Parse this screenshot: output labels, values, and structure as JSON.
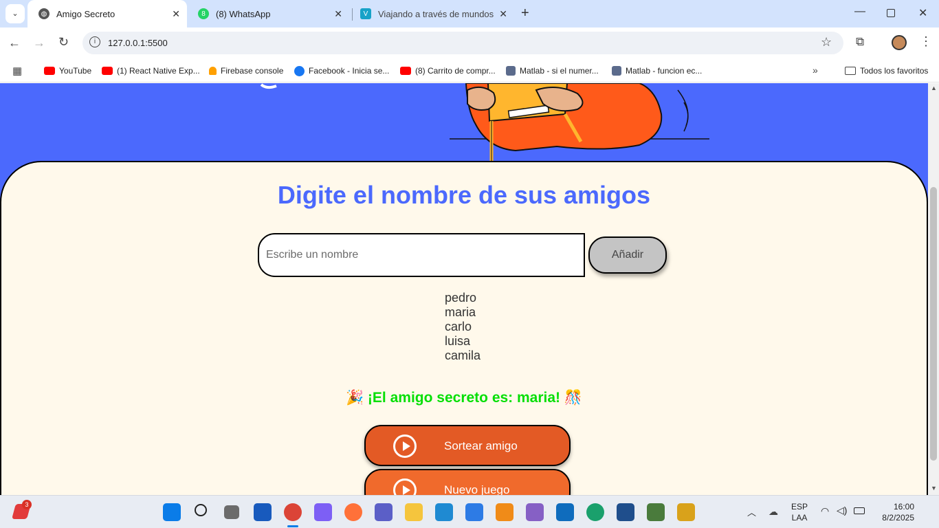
{
  "browser": {
    "tabs": [
      {
        "title": "Amigo Secreto",
        "active": true
      },
      {
        "title": "(8) WhatsApp",
        "active": false
      },
      {
        "title": "Viajando a través de mundos ci",
        "active": false
      }
    ],
    "address": "127.0.0.1:5500",
    "bookmarks": [
      {
        "label": "YouTube",
        "icon": "youtube-icon"
      },
      {
        "label": "(1) React Native Exp...",
        "icon": "youtube-icon"
      },
      {
        "label": "Firebase console",
        "icon": "firebase-icon"
      },
      {
        "label": "Facebook - Inicia se...",
        "icon": "facebook-icon"
      },
      {
        "label": "(8) Carrito de compr...",
        "icon": "youtube-icon"
      },
      {
        "label": "Matlab - si el numer...",
        "icon": "page-icon"
      },
      {
        "label": "Matlab - funcion ec...",
        "icon": "page-icon"
      }
    ],
    "all_bookmarks_label": "Todos los favoritos"
  },
  "page": {
    "heading": "Digite el nombre de sus amigos",
    "input_placeholder": "Escribe un nombre",
    "add_button": "Añadir",
    "friends": [
      "pedro",
      "maria",
      "carlo",
      "luisa",
      "camila"
    ],
    "result": "🎉 ¡El amigo secreto es: maria! 🎊",
    "draw_button": "Sortear amigo",
    "new_game_button": "Nuevo juego"
  },
  "taskbar": {
    "badge": "3",
    "lang_top": "ESP",
    "lang_bottom": "LAA",
    "time": "16:00",
    "date": "8/2/2025"
  },
  "colors": {
    "page_blue": "#4b69fd",
    "card_bg": "#fff9eb",
    "accent_orange": "#e35a25",
    "result_green": "#05df05"
  }
}
